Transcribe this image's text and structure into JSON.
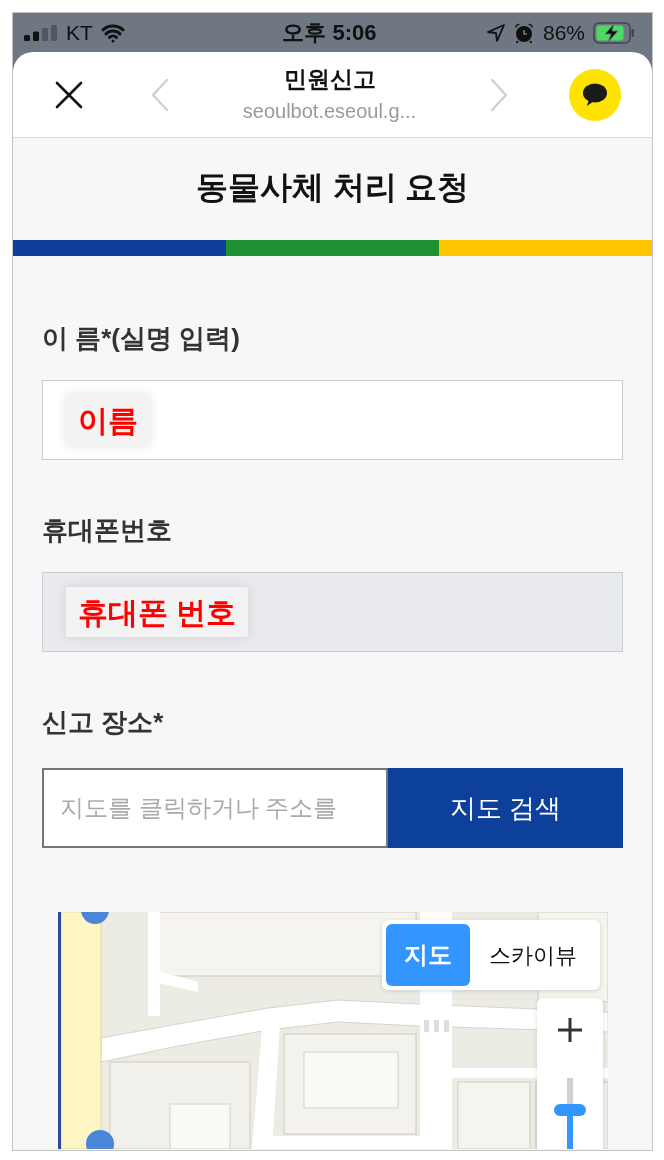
{
  "status_bar": {
    "carrier": "KT",
    "time": "오후 5:06",
    "battery": "86%"
  },
  "browser_header": {
    "title": "민원신고",
    "url": "seoulbot.eseoul.g...",
    "back": {
      "disabled": true
    },
    "forward": {
      "disabled": true
    }
  },
  "page": {
    "title": "동물사체 처리 요청"
  },
  "form": {
    "fields": [
      {
        "kind": "text",
        "label": "이 름*(실명 입력)",
        "value": "이름",
        "disabled": false
      },
      {
        "kind": "text",
        "label": "휴대폰번호",
        "value": "휴대폰 번호",
        "disabled": true
      },
      {
        "kind": "location",
        "label": "신고 장소*",
        "placeholder": "지도를 클릭하거나 주소를",
        "button": "지도 검색"
      }
    ]
  },
  "map": {
    "view_types": [
      {
        "label": "지도",
        "selected": true
      },
      {
        "label": "스카이뷰",
        "selected": false
      }
    ],
    "zoom": {
      "level": 0.55
    }
  }
}
